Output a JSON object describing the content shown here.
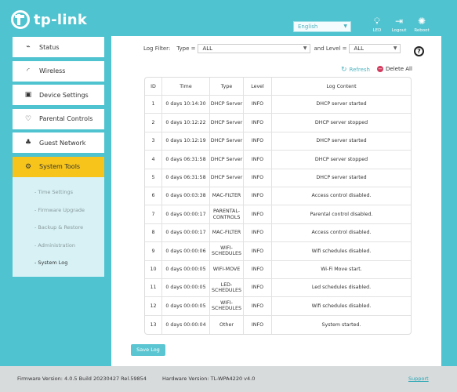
{
  "header": {
    "brand": "tp-link",
    "language": "English",
    "buttons": [
      {
        "name": "led",
        "label": "LED",
        "icon": "lightbulb-icon"
      },
      {
        "name": "logout",
        "label": "Logout",
        "icon": "logout-icon"
      },
      {
        "name": "reboot",
        "label": "Reboot",
        "icon": "reboot-icon"
      }
    ]
  },
  "sidebar": {
    "items": [
      {
        "label": "Status",
        "icon": "pulse-icon"
      },
      {
        "label": "Wireless",
        "icon": "wifi-icon"
      },
      {
        "label": "Device Settings",
        "icon": "settings-icon"
      },
      {
        "label": "Parental Controls",
        "icon": "heart-icon"
      },
      {
        "label": "Guest Network",
        "icon": "users-icon"
      },
      {
        "label": "System Tools",
        "icon": "gear-icon",
        "active": true
      }
    ],
    "submenu": [
      {
        "label": "- Time Settings"
      },
      {
        "label": "- Firmware Upgrade"
      },
      {
        "label": "- Backup & Restore"
      },
      {
        "label": "- Administration"
      },
      {
        "label": "- System Log",
        "active": true
      }
    ]
  },
  "filter": {
    "label": "Log Filter:",
    "type_label": "Type =",
    "type_value": "ALL",
    "level_label": "and Level =",
    "level_value": "ALL"
  },
  "actions": {
    "refresh": "Refresh",
    "delete_all": "Delete All"
  },
  "table": {
    "headers": [
      "ID",
      "Time",
      "Type",
      "Level",
      "Log Content"
    ],
    "rows": [
      {
        "id": "1",
        "time": "0 days 10:14:30",
        "type": "DHCP Server",
        "level": "INFO",
        "content": "DHCP server started"
      },
      {
        "id": "2",
        "time": "0 days 10:12:22",
        "type": "DHCP Server",
        "level": "INFO",
        "content": "DHCP server stopped"
      },
      {
        "id": "3",
        "time": "0 days 10:12:19",
        "type": "DHCP Server",
        "level": "INFO",
        "content": "DHCP server started"
      },
      {
        "id": "4",
        "time": "0 days 06:31:58",
        "type": "DHCP Server",
        "level": "INFO",
        "content": "DHCP server stopped"
      },
      {
        "id": "5",
        "time": "0 days 06:31:58",
        "type": "DHCP Server",
        "level": "INFO",
        "content": "DHCP server started"
      },
      {
        "id": "6",
        "time": "0 days 00:03:38",
        "type": "MAC-FILTER",
        "level": "INFO",
        "content": "Access control disabled."
      },
      {
        "id": "7",
        "time": "0 days 00:00:17",
        "type": "PARENTAL-CONTROLS",
        "level": "INFO",
        "content": "Parental control disabled."
      },
      {
        "id": "8",
        "time": "0 days 00:00:17",
        "type": "MAC-FILTER",
        "level": "INFO",
        "content": "Access control disabled."
      },
      {
        "id": "9",
        "time": "0 days 00:00:06",
        "type": "WIFI-SCHEDULES",
        "level": "INFO",
        "content": "Wifi schedules disabled."
      },
      {
        "id": "10",
        "time": "0 days 00:00:05",
        "type": "WIFI-MOVE",
        "level": "INFO",
        "content": "Wi-Fi Move start."
      },
      {
        "id": "11",
        "time": "0 days 00:00:05",
        "type": "LED-SCHEDULES",
        "level": "INFO",
        "content": "Led schedules disabled."
      },
      {
        "id": "12",
        "time": "0 days 00:00:05",
        "type": "WIFI-SCHEDULES",
        "level": "INFO",
        "content": "Wifi schedules disabled."
      },
      {
        "id": "13",
        "time": "0 days 00:00:04",
        "type": "Other",
        "level": "INFO",
        "content": "System started."
      }
    ]
  },
  "save_button": "Save Log",
  "footer": {
    "firmware": "Firmware Version: 4.0.5 Build 20230427 Rel.59854",
    "hardware": "Hardware Version: TL-WPA4220 v4.0",
    "support": "Support"
  },
  "colors": {
    "background": "#4fc3cf",
    "accent": "#f6c41a",
    "submenu_bg": "#d7f1f5",
    "delete_red": "#d23b5e",
    "button_teal": "#5bc6d1"
  }
}
